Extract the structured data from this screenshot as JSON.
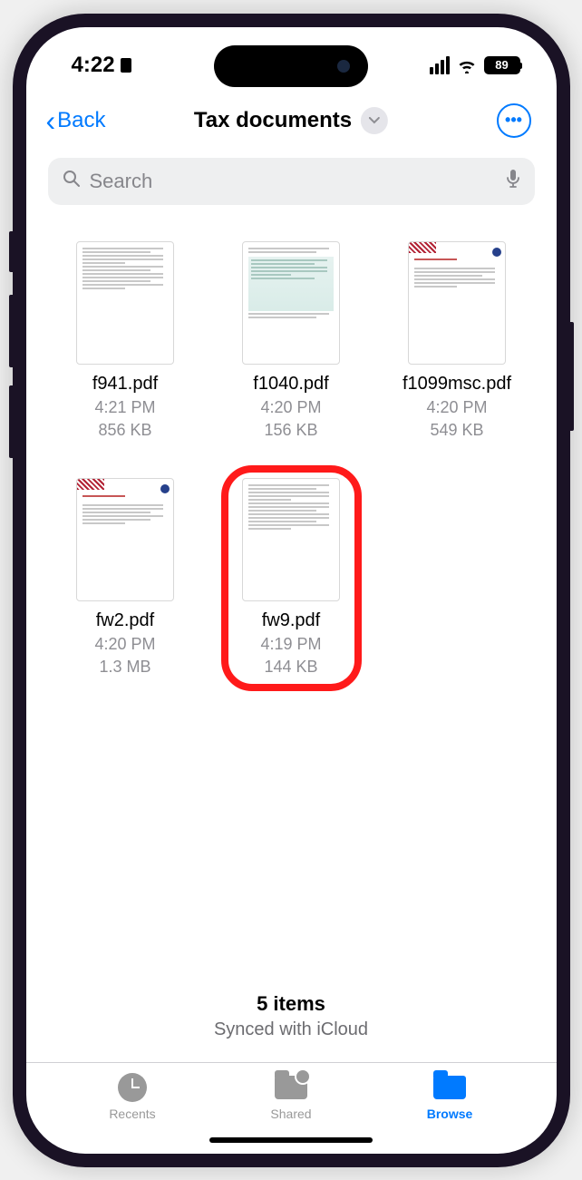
{
  "status": {
    "time": "4:22",
    "battery": "89"
  },
  "nav": {
    "back": "Back",
    "title": "Tax documents"
  },
  "search": {
    "placeholder": "Search"
  },
  "files": [
    {
      "name": "f941.pdf",
      "time": "4:21 PM",
      "size": "856 KB",
      "highlighted": false
    },
    {
      "name": "f1040.pdf",
      "time": "4:20 PM",
      "size": "156 KB",
      "highlighted": false
    },
    {
      "name": "f1099msc.pdf",
      "time": "4:20 PM",
      "size": "549 KB",
      "highlighted": false
    },
    {
      "name": "fw2.pdf",
      "time": "4:20 PM",
      "size": "1.3 MB",
      "highlighted": false
    },
    {
      "name": "fw9.pdf",
      "time": "4:19 PM",
      "size": "144 KB",
      "highlighted": true
    }
  ],
  "summary": {
    "count": "5 items",
    "sync": "Synced with iCloud"
  },
  "tabs": {
    "recents": "Recents",
    "shared": "Shared",
    "browse": "Browse"
  }
}
